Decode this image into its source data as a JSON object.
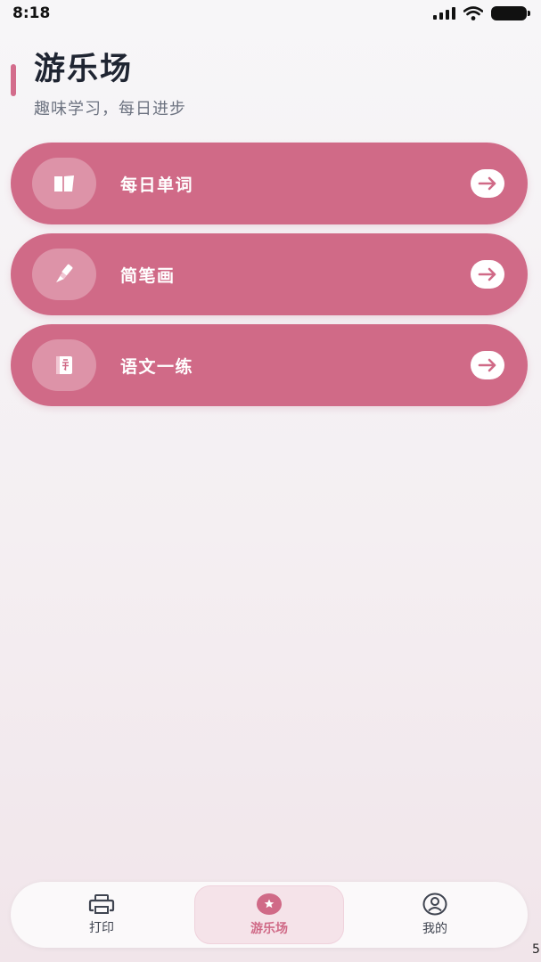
{
  "status_bar": {
    "time": "8:18"
  },
  "header": {
    "title": "游乐场",
    "subtitle": "趣味学习，每日进步"
  },
  "menu": [
    {
      "label": "每日单词",
      "icon": "book-icon"
    },
    {
      "label": "简笔画",
      "icon": "paintbrush-icon"
    },
    {
      "label": "语文一练",
      "icon": "chinese-character-book-icon"
    }
  ],
  "tab_bar": {
    "tabs": [
      {
        "label": "打印",
        "icon": "printer-icon",
        "active": false
      },
      {
        "label": "游乐场",
        "icon": "star-badge-icon",
        "active": true
      },
      {
        "label": "我的",
        "icon": "user-circle-icon",
        "active": false
      }
    ]
  },
  "corner_text": "5",
  "colors": {
    "accent": "#d06a87",
    "card_background": "#d06a87",
    "title_text": "#1f2532",
    "subtitle_text": "#6c7280",
    "tab_active_background": "#f5e3e9"
  }
}
